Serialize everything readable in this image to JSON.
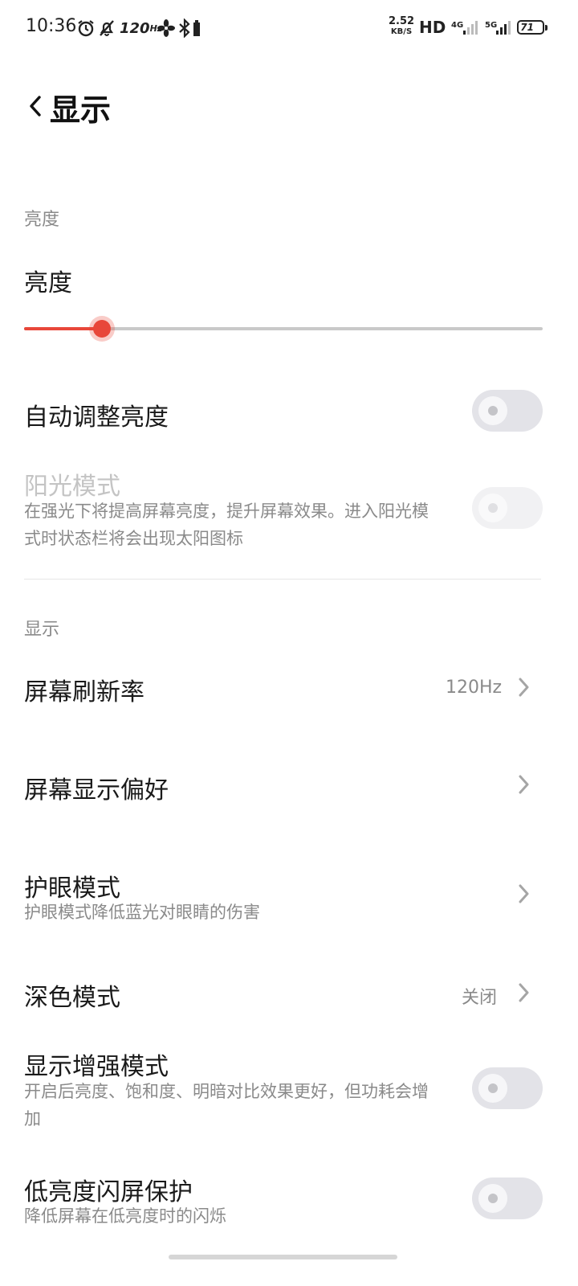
{
  "status_bar": {
    "time": "10:36",
    "refresh_rate_number": "120",
    "refresh_rate_unit": "Hz",
    "net_speed_value": "2.52",
    "net_speed_unit": "KB/S",
    "hd_label": "HD",
    "sim1_label": "4G",
    "sim2_label": "5G",
    "battery_level": "71"
  },
  "header": {
    "title": "显示"
  },
  "brightness_section": {
    "label": "亮度",
    "brightness_title": "亮度",
    "brightness_level": 0.15,
    "accent_color": "#e8473a",
    "auto_brightness": {
      "title": "自动调整亮度",
      "enabled": false
    },
    "sunlight_mode": {
      "title": "阳光模式",
      "subtitle_line1": "在强光下将提高屏幕亮度，提升屏幕效果。进入阳光模",
      "subtitle_line2": "式时状态栏将会出现太阳图标",
      "enabled": false,
      "disabled": true
    }
  },
  "display_section": {
    "label": "显示",
    "refresh_rate": {
      "title": "屏幕刷新率",
      "value": "120Hz"
    },
    "display_preference": {
      "title": "屏幕显示偏好"
    },
    "eye_care": {
      "title": "护眼模式",
      "subtitle": "护眼模式降低蓝光对眼睛的伤害"
    },
    "dark_mode": {
      "title": "深色模式",
      "value": "关闭"
    },
    "enhanced_display": {
      "title": "显示增强模式",
      "subtitle_line1": "开启后亮度、饱和度、明暗对比效果更好，但功耗会增",
      "subtitle_line2": "加",
      "enabled": false
    },
    "low_brightness_flicker": {
      "title": "低亮度闪屏保护",
      "subtitle": "降低屏幕在低亮度时的闪烁",
      "enabled": false
    }
  }
}
